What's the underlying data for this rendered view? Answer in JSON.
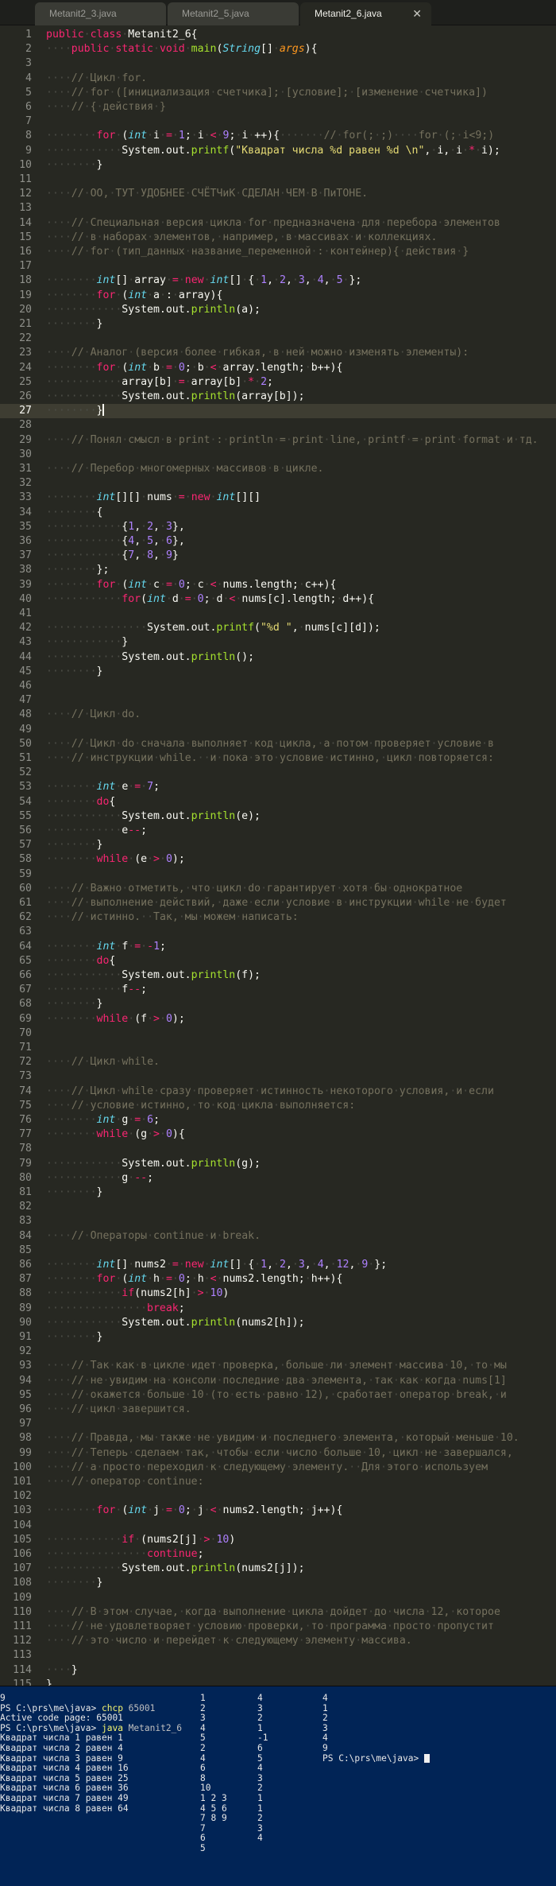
{
  "tabs": [
    {
      "label": "Metanit2_3.java",
      "active": false
    },
    {
      "label": "Metanit2_5.java",
      "active": false
    },
    {
      "label": "Metanit2_6.java",
      "active": true
    }
  ],
  "tab_close_glyph": "✕",
  "editor": {
    "current_line": 27,
    "lines": [
      "public class Metanit2_6{",
      "    public static void main(String[] args){",
      "",
      "    // Цикл for.",
      "    // for ([инициализация счетчика]; [условие]; [изменение счетчика])",
      "    // { действия }",
      "",
      "        for (int i = 1; i < 9; i ++){       // for(; ;)    for (; i<9;)",
      "            System.out.printf(\"Квадрат числа %d равен %d \\n\", i, i * i);",
      "        }",
      "",
      "    // OO, ТУТ УДОБНЕЕ СЧЁТЧиК СДЕЛАН ЧЕМ В ПиТОНЕ.",
      "",
      "    // Специальная версия цикла for предназначена для перебора элементов",
      "    // в наборах элементов, например, в массивах и коллекциях.",
      "    // for (тип_данных название_переменной : контейнер){ действия }",
      "",
      "        int[] array = new int[] { 1, 2, 3, 4, 5 };",
      "        for (int a : array){",
      "            System.out.println(a);",
      "        }",
      "",
      "    // Аналог (версия более гибкая, в ней можно изменять элементы):",
      "        for (int b = 0; b < array.length; b++){",
      "            array[b] = array[b] * 2;",
      "            System.out.println(array[b]);",
      "        }",
      "",
      "    // Понял смысл в print : println = print line, printf = print format и тд.",
      "",
      "    // Перебор многомерных массивов в цикле.",
      "",
      "        int[][] nums = new int[][]",
      "        {",
      "            {1, 2, 3},",
      "            {4, 5, 6},",
      "            {7, 8, 9}",
      "        };",
      "        for (int c = 0; c < nums.length; c++){",
      "            for(int d = 0; d < nums[c].length; d++){",
      "",
      "                System.out.printf(\"%d \", nums[c][d]);",
      "            }",
      "            System.out.println();",
      "        }",
      "",
      "",
      "    // Цикл do.",
      "",
      "    // Цикл do сначала выполняет код цикла, а потом проверяет условие в",
      "    // инструкции while.  и пока это условие истинно, цикл повторяется:",
      "",
      "        int e = 7;",
      "        do{",
      "            System.out.println(e);",
      "            e--;",
      "        }",
      "        while (e > 0);",
      "",
      "    // Важно отметить, что цикл do гарантирует хотя бы однократное",
      "    // выполнение действий, даже если условие в инструкции while не будет",
      "    // истинно.  Так, мы можем написать:",
      "",
      "        int f = -1;",
      "        do{",
      "            System.out.println(f);",
      "            f--;",
      "        }",
      "        while (f > 0);",
      "",
      "",
      "    // Цикл while.",
      "",
      "    // Цикл while сразу проверяет истинность некоторого условия, и если",
      "    // условие истинно, то код цикла выполняется:",
      "        int g = 6;",
      "        while (g > 0){",
      "",
      "            System.out.println(g);",
      "            g --;",
      "        }",
      "",
      "",
      "    // Операторы continue и break.",
      "",
      "        int[] nums2 = new int[] { 1, 2, 3, 4, 12, 9 };",
      "        for (int h = 0; h < nums2.length; h++){",
      "            if(nums2[h] > 10)",
      "                break;",
      "            System.out.println(nums2[h]);",
      "        }",
      "",
      "    // Так как в цикле идет проверка, больше ли элемент массива 10, то мы",
      "    // не увидим на консоли последние два элемента, так как когда nums[1]",
      "    // окажется больше 10 (то есть равно 12), сработает оператор break, и",
      "    // цикл завершится.",
      "",
      "    // Правда, мы также не увидим и последнего элемента, который меньше 10.",
      "    // Теперь сделаем так, чтобы если число больше 10, цикл не завершался,",
      "    // а просто переходил к следующему элементу.  Для этого используем",
      "    // оператор continue:",
      "",
      "        for (int j = 0; j < nums2.length; j++){",
      "",
      "            if (nums2[j] > 10)",
      "                continue;",
      "            System.out.println(nums2[j]);",
      "        }",
      "",
      "    // В этом случае, когда выполнение цикла дойдет до числа 12, которое",
      "    // не удовлетворяет условию проверки, то программа просто пропустит",
      "    // это число и перейдет к следующему элементу массива.",
      "",
      "    }",
      "}"
    ]
  },
  "terminal": {
    "col1": [
      "9",
      "PS C:\\prs\\me\\java> chcp 65001",
      "Active code page: 65001",
      "PS C:\\prs\\me\\java> java Metanit2_6",
      "Квадрат числа 1 равен 1",
      "Квадрат числа 2 равен 4",
      "Квадрат числа 3 равен 9",
      "Квадрат числа 4 равен 16",
      "Квадрат числа 5 равен 25",
      "Квадрат числа 6 равен 36",
      "Квадрат числа 7 равен 49",
      "Квадрат числа 8 равен 64"
    ],
    "col2": [
      "1",
      "2",
      "3",
      "4",
      "5",
      "2",
      "4",
      "6",
      "8",
      "10",
      "1 2 3",
      "4 5 6",
      "7 8 9",
      "7",
      "6",
      "5"
    ],
    "col3": [
      "4",
      "3",
      "2",
      "1",
      "-1",
      "6",
      "5",
      "4",
      "3",
      "2",
      "1",
      "1",
      "2",
      "3",
      "4"
    ],
    "col4": [
      "4",
      "1",
      "2",
      "3",
      "4",
      "9"
    ],
    "prompt": "PS C:\\prs\\me\\java> "
  }
}
